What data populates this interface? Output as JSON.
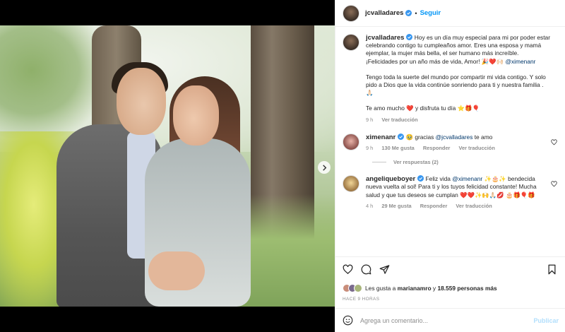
{
  "post": {
    "username": "jcvalladares",
    "follow_label": "Seguir",
    "dot": "•"
  },
  "caption": {
    "username": "jcvalladares",
    "text_p1": "Hoy es un día muy especial para mi por poder estar celebrando contigo tu cumpleaños amor. Eres una esposa y mamá ejemplar, la mujer más bella, el ser humano más increíble. ¡Felicidades por un año más de vida, Amor! 🎉❤️🙌🏻",
    "mention": "@ximenanr",
    "text_p2": "Tengo toda la suerte del mundo por compartir mi vida contigo. Y solo pido a Dios que la vida continúe sonriendo para ti y nuestra familia . 🙏🏻",
    "text_p3": "Te amo mucho ❤️ y disfruta tu día ⭐🎁🎈",
    "time": "9 h",
    "translate": "Ver traducción"
  },
  "comments": [
    {
      "username": "ximenanr",
      "prefix": "🥹 gracias ",
      "mention": "@jcvalladares",
      "suffix": " te amo",
      "time": "9 h",
      "likes": "130 Me gusta",
      "reply": "Responder",
      "translate": "Ver traducción",
      "replies": "Ver respuestas (2)"
    },
    {
      "username": "angeliqueboyer",
      "prefix": "Feliz vida ",
      "mention": "@ximenanr",
      "suffix": " ✨🎂✨ bendecida nueva vuelta al sol! Para ti y los tuyos felicidad constante! Mucha salud y que tus deseos se cumplan ❤️❤️✨🙌🙏🏻💋 🎂🎁🎈🎁",
      "time": "4 h",
      "likes": "29 Me gusta",
      "reply": "Responder",
      "translate": "Ver traducción"
    }
  ],
  "likes": {
    "prefix": "Les gusta a ",
    "user": "marianamro",
    "middle": " y ",
    "others": "18.559 personas más"
  },
  "date": "HACE 9 HORAS",
  "add_comment": {
    "placeholder": "Agrega un comentario...",
    "post_label": "Publicar"
  },
  "colors": {
    "accent": "#0095f6",
    "verified": "#3897f0",
    "mention": "#00376b"
  }
}
